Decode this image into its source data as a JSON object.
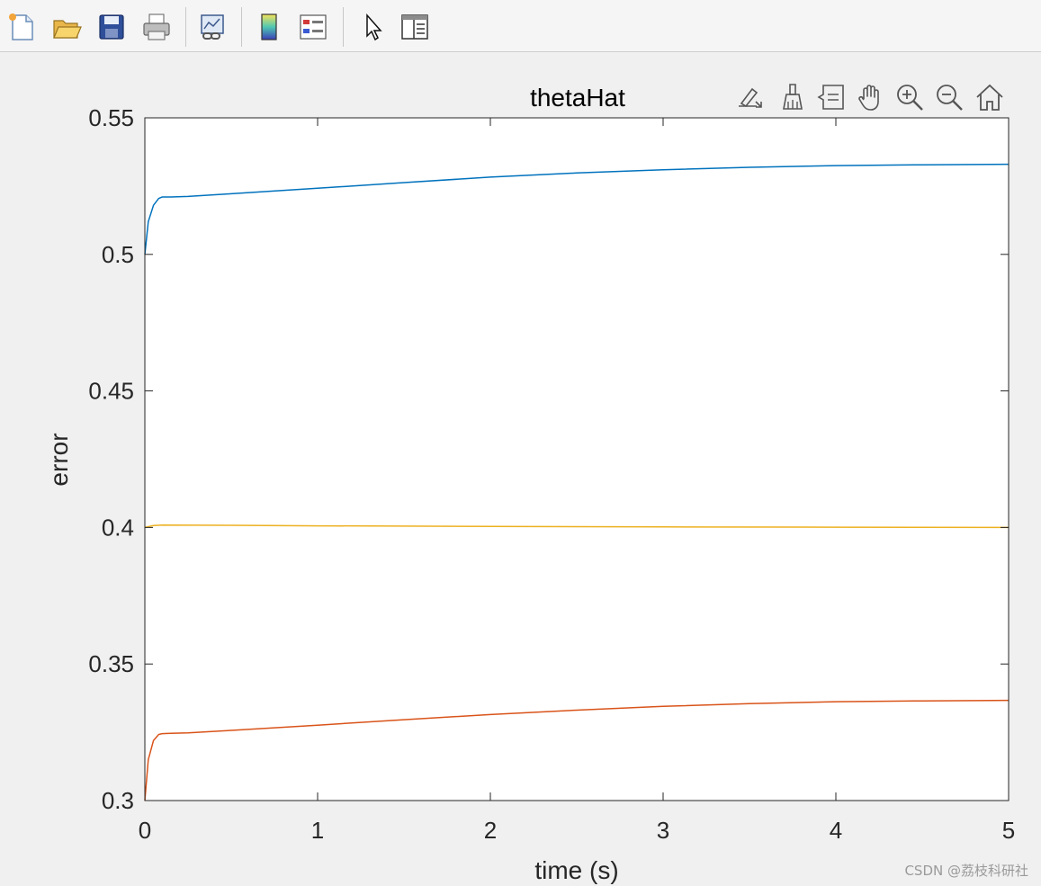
{
  "toolbar": {
    "buttons": [
      {
        "name": "new-figure-icon"
      },
      {
        "name": "open-file-icon"
      },
      {
        "name": "save-icon"
      },
      {
        "name": "print-icon"
      },
      {
        "name": "link-plot-icon"
      },
      {
        "name": "insert-colorbar-icon"
      },
      {
        "name": "insert-legend-icon"
      },
      {
        "name": "edit-plot-pointer-icon"
      },
      {
        "name": "property-inspector-icon"
      }
    ]
  },
  "axes_toolbar": {
    "buttons": [
      {
        "name": "brush-export-icon"
      },
      {
        "name": "brush-icon"
      },
      {
        "name": "data-tips-icon"
      },
      {
        "name": "pan-hand-icon"
      },
      {
        "name": "zoom-in-icon"
      },
      {
        "name": "zoom-out-icon"
      },
      {
        "name": "restore-view-home-icon"
      }
    ]
  },
  "chart_data": {
    "type": "line",
    "title": "thetaHat",
    "xlabel": "time (s)",
    "ylabel": "error",
    "xlim": [
      0,
      5
    ],
    "ylim": [
      0.3,
      0.55
    ],
    "xticks": [
      "0",
      "1",
      "2",
      "3",
      "4",
      "5"
    ],
    "yticks": [
      "0.3",
      "0.35",
      "0.4",
      "0.45",
      "0.5",
      "0.55"
    ],
    "xtick_values": [
      0,
      1,
      2,
      3,
      4,
      5
    ],
    "ytick_values": [
      0.3,
      0.35,
      0.4,
      0.45,
      0.5,
      0.55
    ],
    "grid": false,
    "series": [
      {
        "color": "#0072BD",
        "x": [
          0,
          0.02,
          0.05,
          0.08,
          0.1,
          0.15,
          0.25,
          0.5,
          1.0,
          1.5,
          2.0,
          2.5,
          3.0,
          3.5,
          4.0,
          4.5,
          5.0
        ],
        "y": [
          0.5,
          0.512,
          0.518,
          0.5205,
          0.521,
          0.521,
          0.5212,
          0.5222,
          0.5242,
          0.5263,
          0.5283,
          0.5298,
          0.531,
          0.5319,
          0.5325,
          0.5328,
          0.533
        ]
      },
      {
        "color": "#D95319",
        "x": [
          0,
          0.02,
          0.05,
          0.08,
          0.1,
          0.15,
          0.25,
          0.5,
          1.0,
          1.5,
          2.0,
          2.5,
          3.0,
          3.5,
          4.0,
          4.5,
          5.0
        ],
        "y": [
          0.3,
          0.315,
          0.322,
          0.3242,
          0.3245,
          0.3246,
          0.3248,
          0.3257,
          0.3276,
          0.3296,
          0.3315,
          0.3331,
          0.3345,
          0.3355,
          0.3362,
          0.3365,
          0.3367
        ]
      },
      {
        "color": "#EDB120",
        "x": [
          0,
          0.05,
          0.1,
          0.5,
          1.0,
          2.0,
          3.0,
          4.0,
          5.0
        ],
        "y": [
          0.4,
          0.4007,
          0.4009,
          0.4008,
          0.4006,
          0.4004,
          0.4002,
          0.4001,
          0.4
        ]
      }
    ]
  },
  "watermark": "CSDN @荔枝科研社"
}
